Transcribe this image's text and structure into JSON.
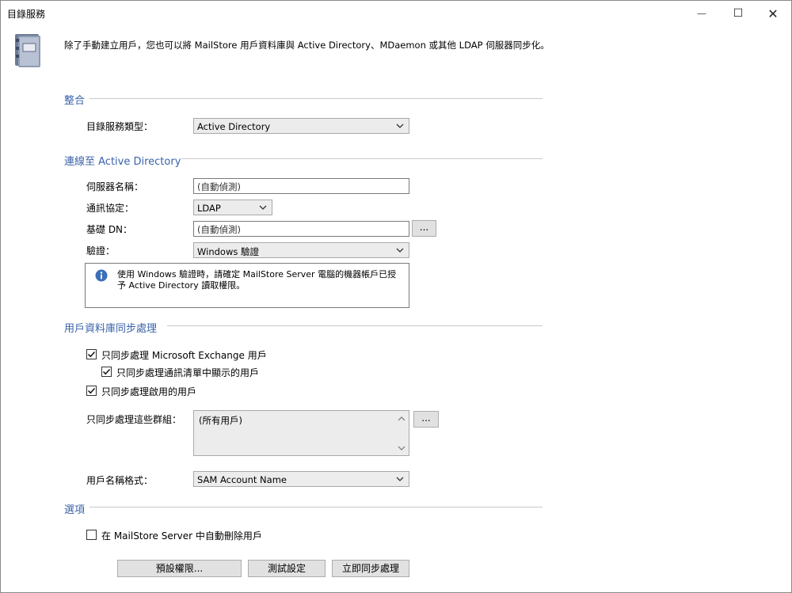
{
  "window": {
    "title": "目錄服務",
    "minimize_glyph": "—",
    "maximize_glyph": "☐",
    "close_glyph": "✕"
  },
  "header": {
    "description": "除了手動建立用戶，您也可以將 MailStore 用戶資料庫與 Active Directory、MDaemon 或其他 LDAP 伺服器同步化。",
    "icon": "address-book-icon"
  },
  "integration": {
    "section_title": "整合",
    "type_label": "目錄服務類型：",
    "type_value": "Active Directory"
  },
  "connection": {
    "section_title": "連線至 Active Directory",
    "server_label": "伺服器名稱：",
    "server_value": "(自動偵測)",
    "protocol_label": "通訊協定：",
    "protocol_value": "LDAP",
    "basedn_label": "基礎 DN：",
    "basedn_value": "(自動偵測)",
    "browse_label": "...",
    "auth_label": "驗證：",
    "auth_value": "Windows 驗證",
    "info_text": "使用 Windows 驗證時，請確定 MailStore Server 電腦的機器帳戶已授予 Active Directory 讀取權限。"
  },
  "sync": {
    "section_title": "用戶資料庫同步處理",
    "opt_exchange": "只同步處理 Microsoft Exchange 用戶",
    "opt_addressbook": "只同步處理通訊清單中顯示的用戶",
    "opt_enabled": "只同步處理啟用的用戶",
    "groups_label": "只同步處理這些群組：",
    "groups_value": "(所有用戶)",
    "groups_browse": "...",
    "username_label": "用戶名稱格式：",
    "username_value": "SAM Account Name"
  },
  "options": {
    "section_title": "選項",
    "opt_autodelete": "在 MailStore Server 中自動刪除用戶"
  },
  "buttons": {
    "default_permissions": "預設權限...",
    "test_settings": "測試設定",
    "sync_now": "立即同步處理"
  },
  "checkbox_state": {
    "exchange": true,
    "addressbook": true,
    "enabled": true,
    "autodelete": false
  }
}
